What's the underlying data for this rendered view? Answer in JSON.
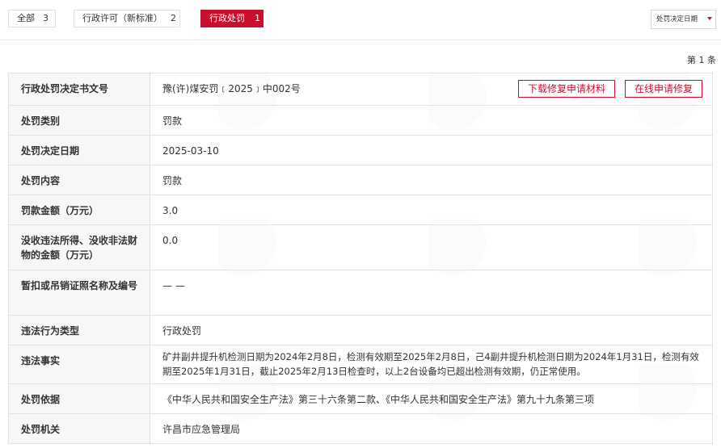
{
  "tabs": [
    {
      "label": "全部",
      "count": "3"
    },
    {
      "label": "行政许可（新标准）",
      "count": "2"
    },
    {
      "label": "行政处罚",
      "count": "1"
    }
  ],
  "sort": {
    "label": "处罚决定日期"
  },
  "count_label": "第 1 条",
  "actions": {
    "download": "下载修复申请材料",
    "online": "在线申请修复"
  },
  "rows": [
    {
      "label": "行政处罚决定书文号",
      "value": "豫(许)煤安罚﹝2025﹞中002号"
    },
    {
      "label": "处罚类别",
      "value": "罚款"
    },
    {
      "label": "处罚决定日期",
      "value": "2025-03-10"
    },
    {
      "label": "处罚内容",
      "value": "罚款"
    },
    {
      "label": "罚款金额（万元）",
      "value": "3.0"
    },
    {
      "label": "没收违法所得、没收非法财物的金额（万元）",
      "value": "0.0"
    },
    {
      "label": "暂扣或吊销证照名称及编号",
      "value": "— —"
    },
    {
      "label": "违法行为类型",
      "value": "行政处罚"
    },
    {
      "label": "违法事实",
      "value": "矿井副井提升机检测日期为2024年2月8日，检测有效期至2025年2月8日，己4副井提升机检测日期为2024年1月31日，检测有效期至2025年1月31日，截止2025年2月13日检查时，以上2台设备均已超出检测有效期，仍正常使用。"
    },
    {
      "label": "处罚依据",
      "value": "《中华人民共和国安全生产法》第三十六条第二款、《中华人民共和国安全生产法》第九十九条第三项"
    },
    {
      "label": "处罚机关",
      "value": "许昌市应急管理局"
    }
  ],
  "colors": {
    "accent": "#c8102e",
    "label_bg": "#f7f7f7",
    "border": "#e2e2e2"
  }
}
